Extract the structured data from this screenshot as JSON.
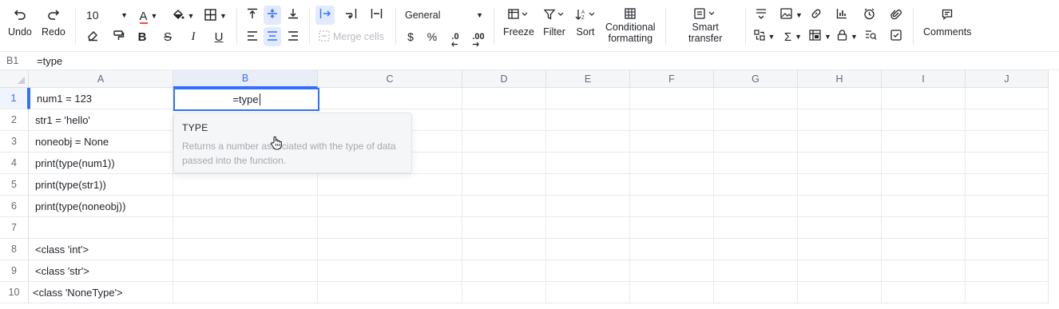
{
  "toolbar": {
    "undo_label": "Undo",
    "redo_label": "Redo",
    "font_size": "10",
    "number_format": "General",
    "merge_label": "Merge cells",
    "currency_symbol": "$",
    "percent_symbol": "%",
    "decrease_decimal": ".0",
    "increase_decimal": ".00",
    "freeze_label": "Freeze",
    "filter_label": "Filter",
    "sort_label": "Sort",
    "conditional_label_1": "Conditional",
    "conditional_label_2": "formatting",
    "smart_label_1": "Smart",
    "smart_label_2": "transfer",
    "comments_label": "Comments",
    "bold": "B",
    "italic": "I",
    "underline": "U",
    "strike": "S",
    "text_color": "A",
    "accent_color": "#3370ff",
    "text_color_underline": "#f54a45"
  },
  "formula_bar": {
    "cell_ref": "B1",
    "formula": "=type"
  },
  "grid": {
    "columns": [
      "A",
      "B",
      "C",
      "D",
      "E",
      "F",
      "G",
      "H",
      "I",
      "J"
    ],
    "rows": [
      "1",
      "2",
      "3",
      "4",
      "5",
      "6",
      "7",
      "8",
      "9",
      "10"
    ],
    "col_a_values": [
      "num1 = 123",
      "str1 = 'hello'",
      "noneobj = None",
      "print(type(num1))",
      "print(type(str1))",
      "print(type(noneobj))",
      "",
      "<class 'int'>",
      "<class 'str'>",
      "<class 'NoneType'>"
    ],
    "active_cell_value": "=type"
  },
  "tooltip": {
    "function_name": "TYPE",
    "description": "Returns a number associated with the type of data passed into the function."
  }
}
